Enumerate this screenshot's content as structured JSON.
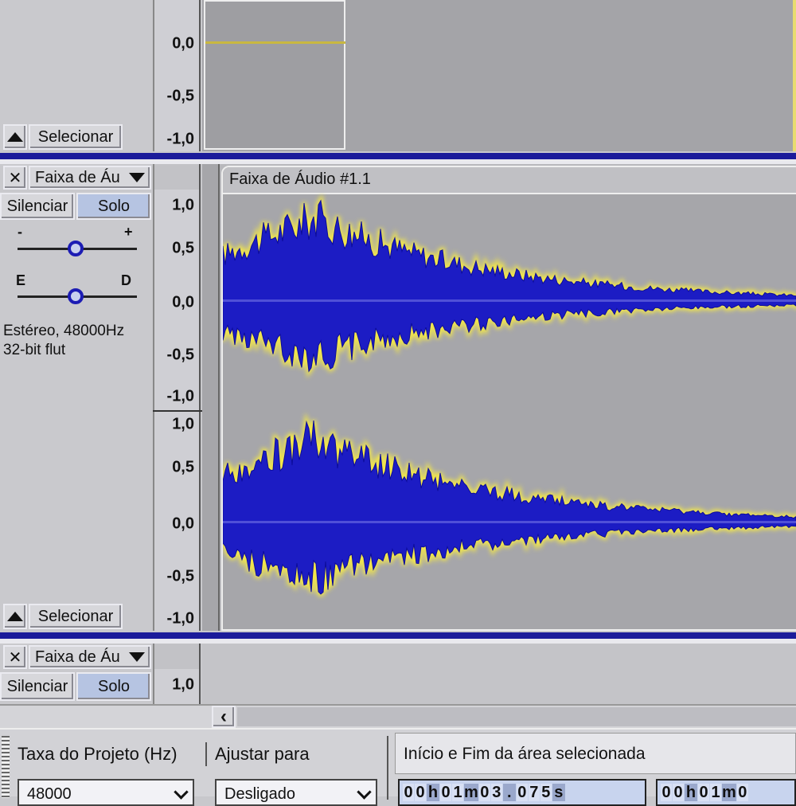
{
  "top_track": {
    "ruler": [
      "0,0",
      "-0,5",
      "-1,0"
    ],
    "select_label": "Selecionar"
  },
  "track1": {
    "close_glyph": "✕",
    "name": "Faixa de Áu",
    "mute_label": "Silenciar",
    "solo_label": "Solo",
    "gain_minus": "-",
    "gain_plus": "+",
    "pan_left": "E",
    "pan_right": "D",
    "info_line1": "Estéreo, 48000Hz",
    "info_line2": "32-bit flut",
    "clip_title": "Faixa de Áudio #1.1",
    "ruler_upper": [
      "1,0",
      "0,5",
      "0,0",
      "-0,5",
      "-1,0"
    ],
    "ruler_lower": [
      "1,0",
      "0,5",
      "0,0",
      "-0,5",
      "-1,0"
    ],
    "select_label": "Selecionar"
  },
  "track2": {
    "close_glyph": "✕",
    "name": "Faixa de Áu",
    "mute_label": "Silenciar",
    "solo_label": "Solo",
    "ruler_top": "1,0"
  },
  "scroll": {
    "left_arrow": "‹"
  },
  "selection_toolbar": {
    "project_rate_label": "Taxa do Projeto (Hz)",
    "snap_label": "Ajustar para",
    "selection_label": "Início e Fim da área selecionada",
    "project_rate_value": "48000",
    "snap_value": "Desligado",
    "start_time": [
      "0",
      "0",
      "h",
      "0",
      "1",
      "m",
      "0",
      "3",
      ".",
      "0",
      "7",
      "5",
      "s"
    ],
    "end_time": [
      "0",
      "0",
      "h",
      "0",
      "1",
      "m",
      "0"
    ]
  },
  "colors": {
    "wave": "#1c1cc4",
    "wave_glow": "#f2e64a",
    "separator": "#1b1b9a"
  }
}
